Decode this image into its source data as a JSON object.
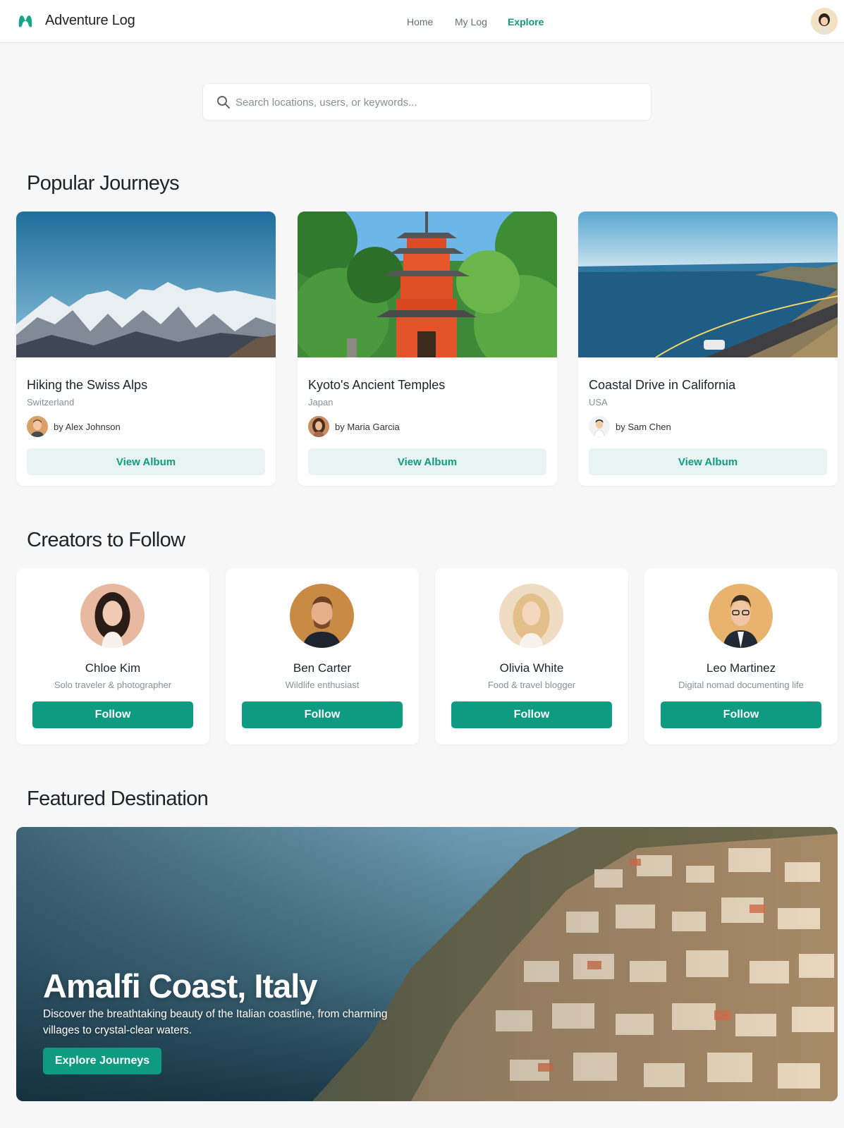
{
  "header": {
    "app_title": "Adventure Log",
    "nav": [
      {
        "label": "Home",
        "active": false
      },
      {
        "label": "My Log",
        "active": false
      },
      {
        "label": "Explore",
        "active": true
      }
    ],
    "accent_color": "#119a82"
  },
  "search": {
    "placeholder": "Search locations, users, or keywords...",
    "value": "",
    "icon": "search-icon"
  },
  "popular": {
    "title": "Popular Journeys",
    "cards": [
      {
        "title": "Hiking the Swiss Alps",
        "location": "Switzerland",
        "author": "by Alex Johnson",
        "button": "View Album",
        "image": "snowy-mountains"
      },
      {
        "title": "Kyoto's Ancient Temples",
        "location": "Japan",
        "author": "by Maria Garcia",
        "button": "View Album",
        "image": "red-pagoda"
      },
      {
        "title": "Coastal Drive in California",
        "location": "USA",
        "author": "by Sam Chen",
        "button": "View Album",
        "image": "coastal-road"
      }
    ]
  },
  "creators": {
    "title": "Creators to Follow",
    "items": [
      {
        "name": "Chloe Kim",
        "bio": "Solo traveler & photographer",
        "button": "Follow"
      },
      {
        "name": "Ben Carter",
        "bio": "Wildlife enthusiast",
        "button": "Follow"
      },
      {
        "name": "Olivia White",
        "bio": "Food & travel blogger",
        "button": "Follow"
      },
      {
        "name": "Leo Martinez",
        "bio": "Digital nomad documenting life",
        "button": "Follow"
      }
    ]
  },
  "featured": {
    "section_title": "Featured Destination",
    "title": "Amalfi Coast, Italy",
    "description": "Discover the breathtaking beauty of the Italian coastline, from charming villages to crystal-clear waters.",
    "button": "Explore Journeys",
    "image": "amalfi-cliffside-village"
  }
}
